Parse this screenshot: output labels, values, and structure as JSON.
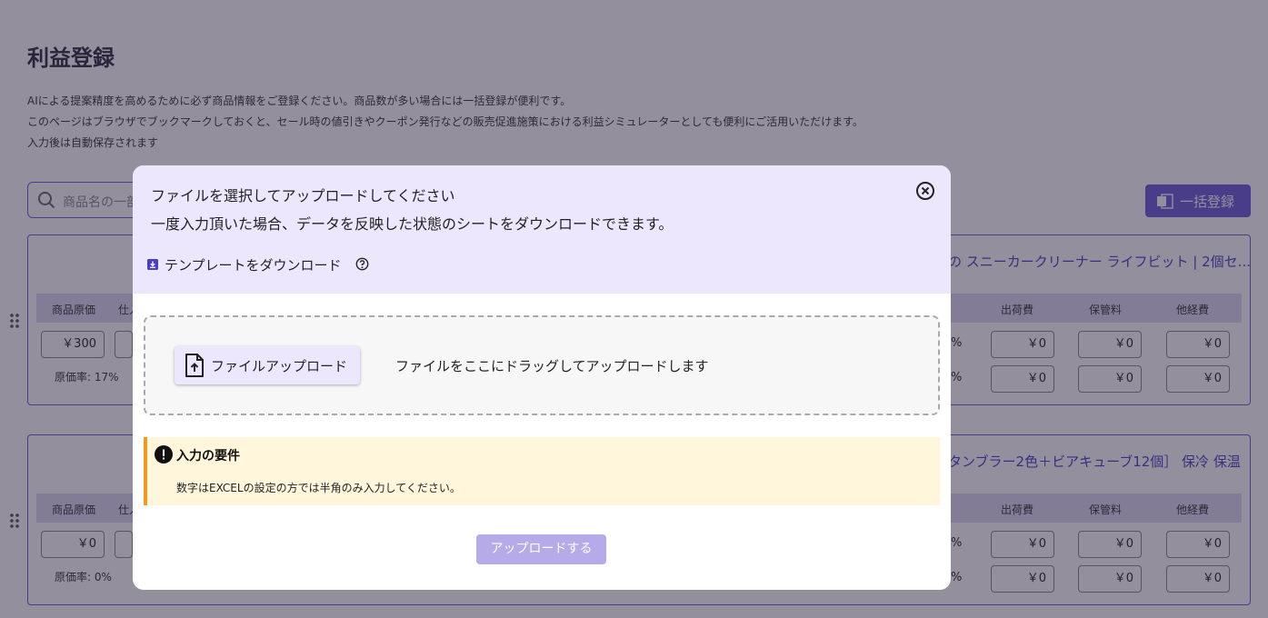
{
  "page": {
    "title": "利益登録",
    "desc_lines": [
      "AIによる提案精度を高めるために必ず商品情報をご登録ください。商品数が多い場合には一括登録が便利です。",
      "このページはブラウザでブックマークしておくと、セール時の値引きやクーポン発行などの販売促進施策における利益シミュレーターとしても便利にご活用いただけます。",
      "入力後は自動保存されます"
    ],
    "search_placeholder": "商品名の一部",
    "bulk_button": "一括登録"
  },
  "cards": [
    {
      "product_name": "の スニーカークリーナー ライフビット | 2個セ...",
      "headers": {
        "cost": "商品原価",
        "purchase": "仕入",
        "shipping": "出荷費",
        "storage": "保管料",
        "other": "他経費"
      },
      "row1": {
        "cost": "￥300",
        "shipping": "￥0",
        "storage": "￥0",
        "other": "￥0"
      },
      "row2": {
        "shipping": "￥0",
        "storage": "￥0",
        "other": "￥0"
      },
      "pct": "%",
      "cost_ratio": "原価率:  17%"
    },
    {
      "product_name": "タンブラー2色＋ビアキューブ12個］ 保冷 保温",
      "headers": {
        "cost": "商品原価",
        "purchase": "仕入",
        "shipping": "出荷費",
        "storage": "保管料",
        "other": "他経費"
      },
      "row1": {
        "cost": "￥0",
        "shipping": "￥0",
        "storage": "￥0",
        "other": "￥0"
      },
      "row2": {
        "shipping": "￥0",
        "storage": "￥0",
        "other": "￥0"
      },
      "pct": "%",
      "cost_ratio": "原価率:  0%"
    }
  ],
  "modal": {
    "line1": "ファイルを選択してアップロードしてください",
    "line2": "一度入力頂いた場合、データを反映した状態のシートをダウンロードできます。",
    "template_link": "テンプレートをダウンロード",
    "upload_button": "ファイルアップロード",
    "drop_hint": "ファイルをここにドラッグしてアップロードします",
    "requirements_title": "入力の要件",
    "requirements_text": "数字はEXCELの設定の方では半角のみ入力してください。",
    "submit_button": "アップロードする"
  },
  "colors": {
    "accent": "#6b5bd6",
    "modal_header": "#ece7fd",
    "warning_border": "#f09a1e",
    "warning_bg": "#fff6dc",
    "submit_disabled": "#b7aae8"
  },
  "icons": [
    "search-icon",
    "excel-icon",
    "drag-handle-icon",
    "close-icon",
    "download-icon",
    "help-icon",
    "file-upload-icon",
    "warning-icon"
  ]
}
